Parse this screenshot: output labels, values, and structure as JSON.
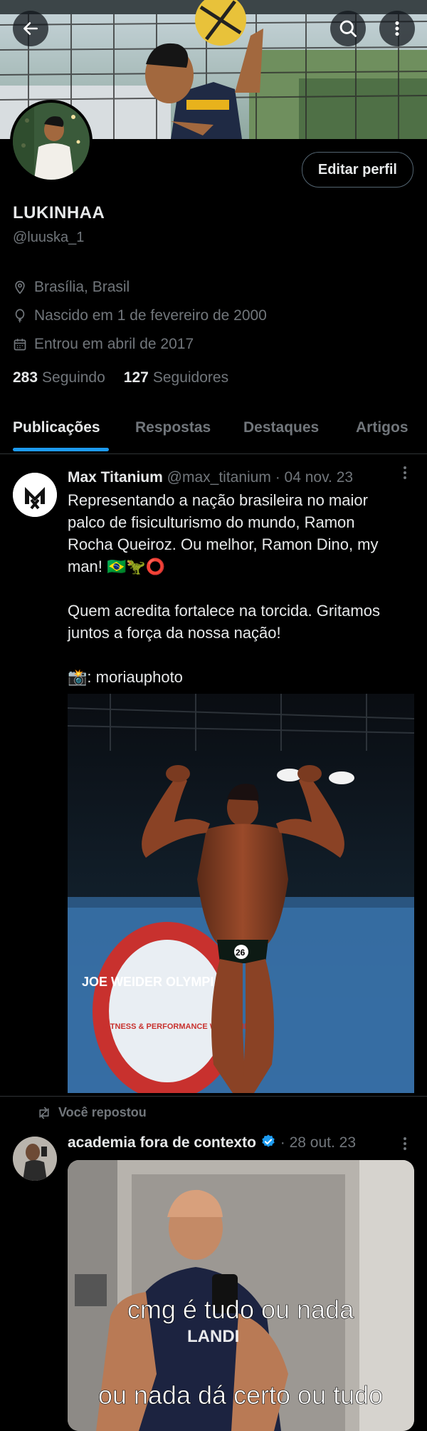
{
  "header": {
    "back_icon": "arrow-left-icon",
    "search_icon": "search-icon",
    "more_icon": "more-vertical-icon"
  },
  "profile": {
    "edit_button": "Editar perfil",
    "name": "LUKINHAA",
    "handle": "@luuska_1",
    "location": "Brasília, Brasil",
    "birth": "Nascido em 1 de fevereiro de 2000",
    "joined": "Entrou em abril de 2017",
    "following_count": "283",
    "following_label": "Seguindo",
    "followers_count": "127",
    "followers_label": "Seguidores"
  },
  "tabs": [
    {
      "label": "Publicações",
      "active": true
    },
    {
      "label": "Respostas",
      "active": false
    },
    {
      "label": "Destaques",
      "active": false
    },
    {
      "label": "Artigos",
      "active": false
    }
  ],
  "posts": [
    {
      "author": "Max Titanium",
      "handle": "@max_titanium",
      "date": "· 04 nov. 23",
      "avatar_text": "MAX",
      "lines": [
        "Representando a nação brasileira no maior",
        "palco de fisiculturismo do mundo, Ramon",
        "Rocha Queiroz. Ou melhor, Ramon Dino, my",
        "man! 🇧🇷🦖⭕"
      ],
      "lines2": [
        "Quem acredita fortalece na torcida. Gritamos",
        "juntos a força da nossa nação!"
      ],
      "credit": "📸: moriauphoto",
      "image_banner_text": "JOE WEIDER OLYMPIA",
      "image_banner_sub": "FITNESS & PERFORMANCE WEEKEND 2023",
      "bib_number": "26"
    },
    {
      "repost_label": "Você repostou",
      "author": "academia fora de contexto",
      "date": "· 28 out. 23",
      "verified": true,
      "caption_line1": "cmg é tudo ou nada",
      "caption_line2": "ou nada dá certo ou tudo",
      "shirt_text": "LANDI"
    }
  ],
  "colors": {
    "background": "#000000",
    "accent": "#1d9bf0",
    "muted": "#71767b",
    "text": "#e7e9ea",
    "divider": "#2f3336"
  }
}
